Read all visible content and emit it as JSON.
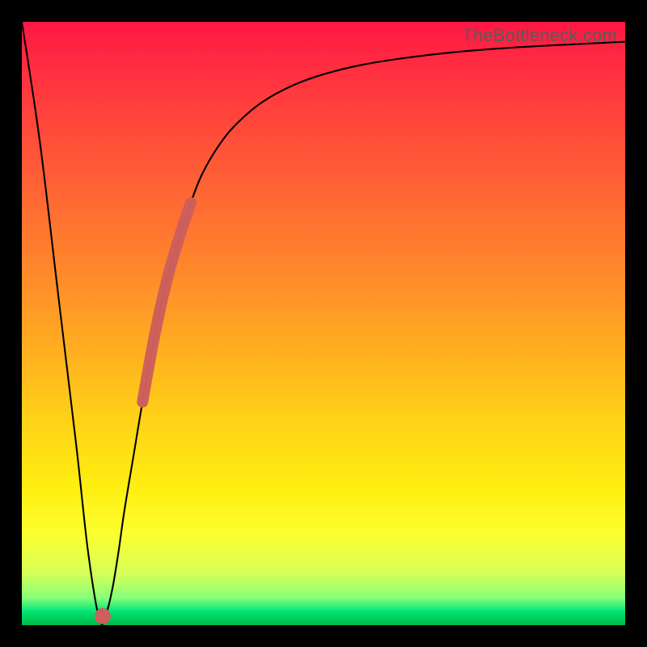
{
  "watermark": "TheBottleneck.com",
  "colors": {
    "highlight": "#cd5f5c",
    "curve": "#000000",
    "frame": "#000000"
  },
  "chart_data": {
    "type": "line",
    "title": "",
    "xlabel": "",
    "ylabel": "",
    "xlim": [
      0,
      100
    ],
    "ylim": [
      0,
      100
    ],
    "grid": false,
    "legend": false,
    "series": [
      {
        "name": "bottleneck-curve",
        "x": [
          0,
          3,
          6,
          9,
          11,
          12.9,
          14,
          15,
          16,
          17,
          18.5,
          20,
          22,
          24,
          26,
          28,
          30,
          33,
          36,
          40,
          45,
          50,
          56,
          62,
          70,
          78,
          86,
          94,
          100
        ],
        "y": [
          100,
          80,
          55,
          30,
          12,
          0.8,
          2,
          6,
          12,
          19,
          28,
          37,
          48,
          57,
          64,
          70,
          75,
          80,
          83.5,
          86.8,
          89.5,
          91.3,
          92.8,
          93.8,
          94.8,
          95.5,
          96,
          96.4,
          96.7
        ]
      },
      {
        "name": "highlight-segment",
        "x": [
          20,
          22,
          24,
          26,
          28
        ],
        "y": [
          37,
          48,
          57,
          64,
          70
        ],
        "style": "thick"
      },
      {
        "name": "highlight-dot",
        "x": [
          13.4
        ],
        "y": [
          1.5
        ],
        "style": "point"
      }
    ]
  }
}
